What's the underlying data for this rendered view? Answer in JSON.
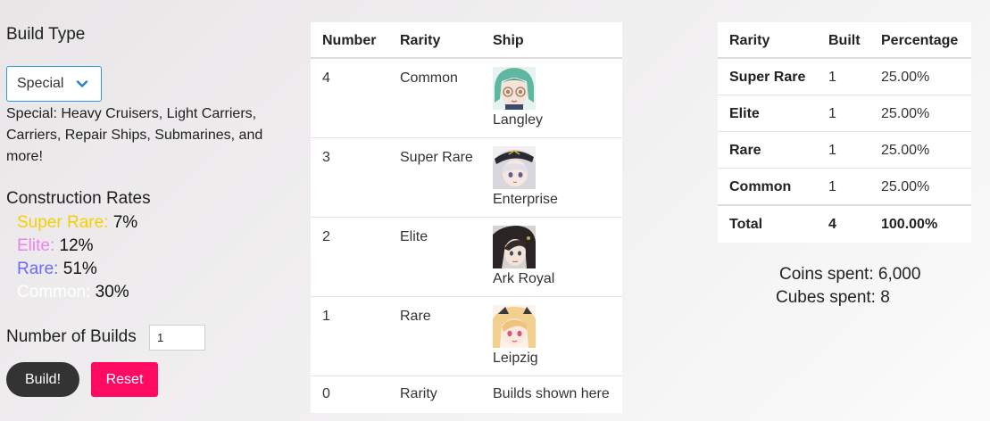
{
  "build_type": {
    "label": "Build Type",
    "selected": "Special",
    "description": "Special: Heavy Cruisers, Light Carriers, Carriers, Repair Ships, Submarines, and more!"
  },
  "construction_rates": {
    "title": "Construction Rates",
    "rates": [
      {
        "name": "Super Rare:",
        "value": "7%",
        "color": "#f5d000"
      },
      {
        "name": "Elite:",
        "value": "12%",
        "color": "#ee82ee"
      },
      {
        "name": "Rare:",
        "value": "51%",
        "color": "#6a6aff"
      },
      {
        "name": "Common:",
        "value": "30%",
        "color": "#ffffff"
      }
    ]
  },
  "builds_input": {
    "label": "Number of Builds",
    "value": "1"
  },
  "buttons": {
    "build": "Build!",
    "reset": "Reset"
  },
  "builds_table": {
    "headers": [
      "Number",
      "Rarity",
      "Ship"
    ],
    "rows": [
      {
        "number": "4",
        "rarity": "Common",
        "ship": "Langley",
        "portrait": "ship-portrait-langley"
      },
      {
        "number": "3",
        "rarity": "Super Rare",
        "ship": "Enterprise",
        "portrait": "ship-portrait-enterprise"
      },
      {
        "number": "2",
        "rarity": "Elite",
        "ship": "Ark Royal",
        "portrait": "ship-portrait-ark-royal"
      },
      {
        "number": "1",
        "rarity": "Rare",
        "ship": "Leipzig",
        "portrait": "ship-portrait-leipzig"
      }
    ],
    "placeholder_row": {
      "number": "0",
      "rarity": "Rarity",
      "ship": "Builds shown here"
    }
  },
  "summary_table": {
    "headers": [
      "Rarity",
      "Built",
      "Percentage"
    ],
    "rows": [
      {
        "rarity": "Super Rare",
        "built": "1",
        "percentage": "25.00%"
      },
      {
        "rarity": "Elite",
        "built": "1",
        "percentage": "25.00%"
      },
      {
        "rarity": "Rare",
        "built": "1",
        "percentage": "25.00%"
      },
      {
        "rarity": "Common",
        "built": "1",
        "percentage": "25.00%"
      }
    ],
    "total": {
      "label": "Total",
      "built": "4",
      "percentage": "100.00%"
    }
  },
  "spent": {
    "coins": "Coins spent: 6,000",
    "cubes": "Cubes spent: 8"
  }
}
